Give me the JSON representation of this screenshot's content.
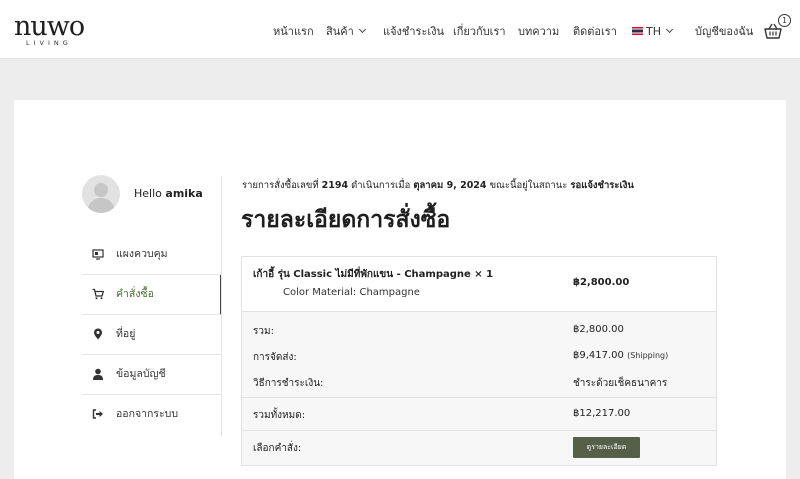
{
  "brand": {
    "name": "nuwo",
    "tagline": "LIVING"
  },
  "nav": {
    "items": [
      {
        "label": "หน้าแรก"
      },
      {
        "label": "สินค้า"
      },
      {
        "label": "แจ้งชำระเงิน"
      },
      {
        "label": "เกี่ยวกับเรา"
      },
      {
        "label": "บทความ"
      },
      {
        "label": "ติดต่อเรา"
      },
      {
        "label": "TH"
      },
      {
        "label": "บัญชีของฉัน"
      }
    ],
    "cart_count": "1"
  },
  "account": {
    "hello": "Hello",
    "username": "amika",
    "menu": [
      {
        "label": "แผงควบคุม",
        "icon": "dashboard-icon"
      },
      {
        "label": "คำสั่งซื้อ",
        "icon": "cart-icon"
      },
      {
        "label": "ที่อยู่",
        "icon": "map-marker-icon"
      },
      {
        "label": "ข้อมูลบัญชี",
        "icon": "user-icon"
      },
      {
        "label": "ออกจากระบบ",
        "icon": "sign-out-icon"
      }
    ]
  },
  "order": {
    "status_prefix": "รายการสั่งซื้อเลขที่",
    "number": "2194",
    "placed_on_text": "ดำเนินการเมื่อ",
    "date": "ตุลาคม 9, 2024",
    "status_text": "ขณะนี้อยู่ในสถานะ",
    "status": "รอแจ้งชำระเงิน",
    "title": "รายละเอียดการสั่งซื้อ",
    "item": {
      "name": "เก้าอี้ รุ่น Classic ไม่มีที่พักแขน - Champagne × 1",
      "meta": "Color Material: Champagne",
      "total": "฿2,800.00"
    },
    "totals": [
      {
        "label": "รวม:",
        "value": "฿2,800.00",
        "note": ""
      },
      {
        "label": "การจัดส่ง:",
        "value": "฿9,417.00",
        "note": "(Shipping)"
      },
      {
        "label": "วิธีการชำระเงิน:",
        "value": "ชำระด้วยเช็คธนาคาร",
        "note": ""
      }
    ],
    "grand_total": {
      "label": "รวมทั้งหมด:",
      "value": "฿12,217.00"
    },
    "actions": {
      "label": "เลือกคำสั่ง:",
      "button": "ดูรายละเอียด"
    }
  }
}
